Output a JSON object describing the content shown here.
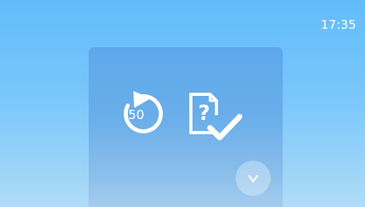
{
  "status_bar": {
    "time": "17:35"
  },
  "card": {
    "rewind_button": {
      "icon": "rewind-circle-icon",
      "value": "50"
    },
    "quiz_button": {
      "icon": "document-question-check-icon",
      "glyph": "?"
    },
    "expand_button": {
      "icon": "chevron-down-icon"
    }
  },
  "colors": {
    "background_top": "#62bdfb",
    "background_bottom": "#b0dcf7",
    "card_top": "#5ea8eb",
    "card_bottom": "#a5cced",
    "icon": "#ffffff"
  }
}
